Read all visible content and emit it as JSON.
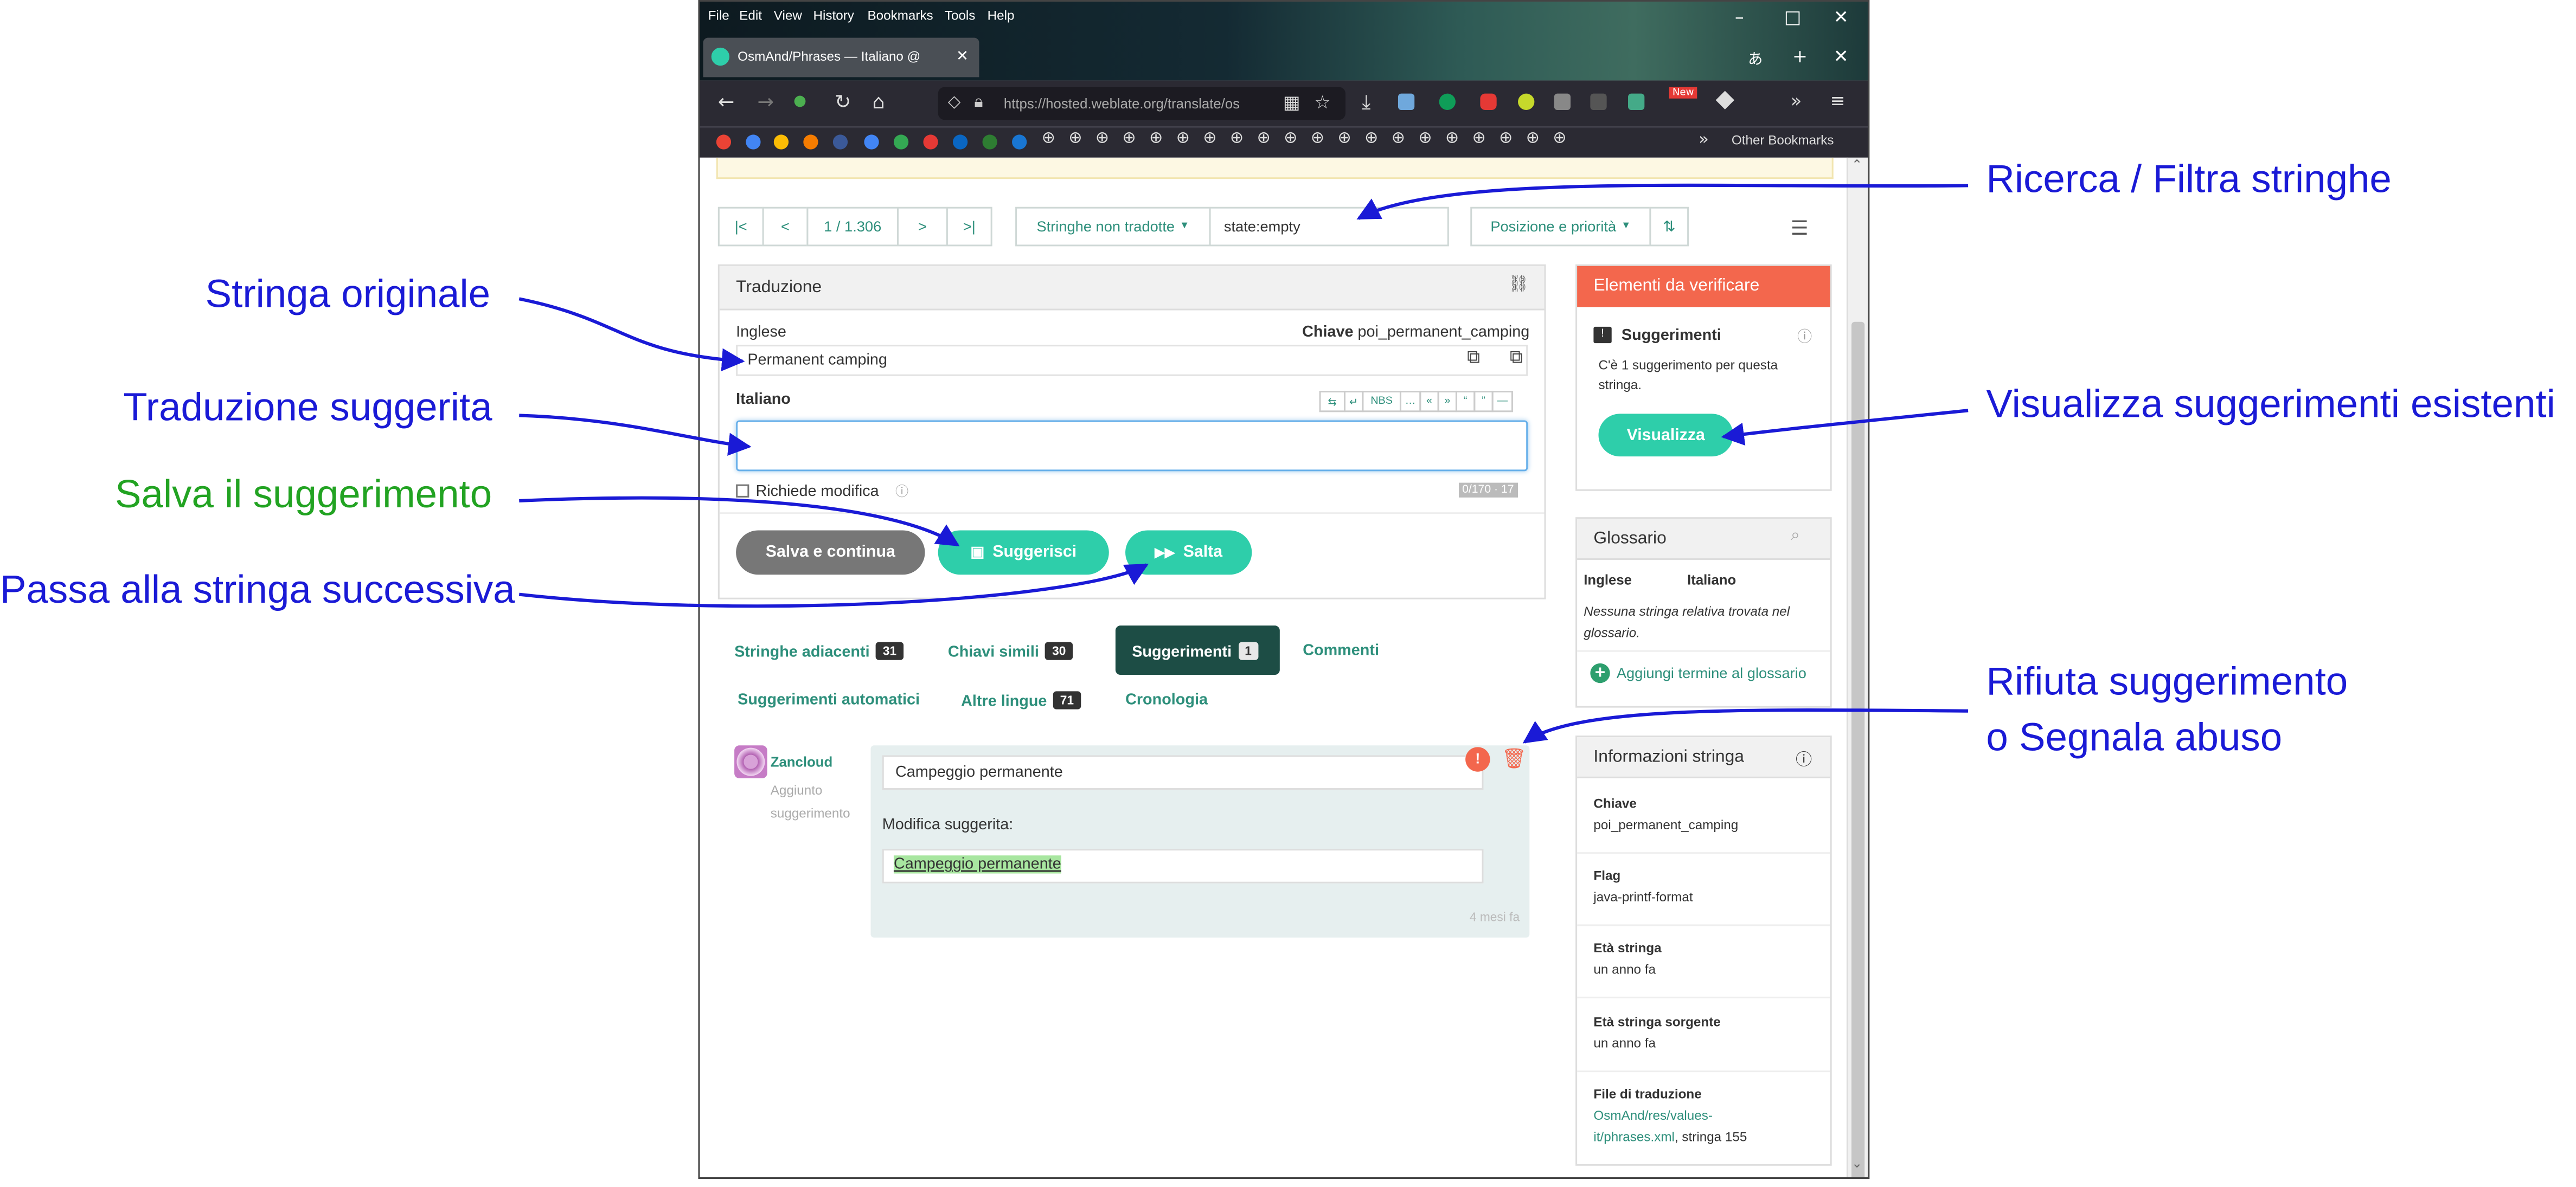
{
  "browser": {
    "menu": [
      "File",
      "Edit",
      "View",
      "History",
      "Bookmarks",
      "Tools",
      "Help"
    ],
    "tab_title": "OsmAnd/Phrases — Italiano @",
    "url": "https://hosted.weblate.org/translate/os",
    "other_bookmarks": "Other Bookmarks",
    "new_badge": "New"
  },
  "toolbar": {
    "position": "1 / 1.306",
    "filter_dropdown": "Stringhe non tradotte",
    "search_query": "state:empty",
    "sort_dropdown": "Posizione e priorità"
  },
  "translation": {
    "panel_title": "Traduzione",
    "source_lang": "Inglese",
    "key_label": "Chiave",
    "key_value": "poi_permanent_camping",
    "source_text": "Permanent camping",
    "target_lang": "Italiano",
    "kb_buttons": [
      "⇆",
      "↵",
      "NBS",
      "…",
      "«",
      "»",
      "“",
      "”",
      "—"
    ],
    "needs_edit_label": "Richiede modifica",
    "char_counter": "0/170 · 17",
    "save_button": "Salva e continua",
    "suggest_button": "Suggerisci",
    "skip_button": "Salta"
  },
  "tabs": [
    {
      "label": "Stringhe adiacenti",
      "count": "31"
    },
    {
      "label": "Chiavi simili",
      "count": "30"
    },
    {
      "label": "Suggerimenti",
      "count": "1"
    },
    {
      "label": "Commenti",
      "count": ""
    },
    {
      "label": "Suggerimenti automatici",
      "count": ""
    },
    {
      "label": "Altre lingue",
      "count": "71"
    },
    {
      "label": "Cronologia",
      "count": ""
    }
  ],
  "suggestion": {
    "user": "Zancloud",
    "action_line1": "Aggiunto",
    "action_line2": "suggerimento",
    "text": "Campeggio permanente",
    "diff_label": "Modifica suggerita:",
    "diff_text": "Campeggio permanente",
    "age": "4 mesi fa"
  },
  "sidebar": {
    "check_title": "Elementi da verificare",
    "check_heading": "Suggerimenti",
    "check_desc_1": "C'è 1 suggerimento per questa",
    "check_desc_2": "stringa.",
    "view_button": "Visualizza",
    "glossary_title": "Glossario",
    "glossary_col1": "Inglese",
    "glossary_col2": "Italiano",
    "glossary_empty_1": "Nessuna stringa relativa trovata nel",
    "glossary_empty_2": "glossario.",
    "glossary_add": "Aggiungi termine al glossario",
    "info_title": "Informazioni stringa",
    "info": [
      {
        "label": "Chiave",
        "value": "poi_permanent_camping"
      },
      {
        "label": "Flag",
        "value": "java-printf-format"
      },
      {
        "label": "Età stringa",
        "value": "un anno fa"
      },
      {
        "label": "Età stringa sorgente",
        "value": "un anno fa"
      },
      {
        "label": "File di traduzione",
        "value": "OsmAnd/res/values-",
        "value2": "it/phrases.xml",
        "value3": ", stringa 155"
      }
    ]
  },
  "annotations": {
    "search_filter": "Ricerca / Filtra stringhe",
    "original": "Stringa originale",
    "suggested": "Traduzione suggerita",
    "save_suggestion": "Salva il suggerimento",
    "next_string": "Passa alla stringa successiva",
    "view_existing": "Visualizza suggerimenti esistenti",
    "reject_line1": "Rifiuta suggerimento",
    "reject_line2": "o Segnala abuso"
  },
  "colors": {
    "accent": "#2eceaa",
    "link": "#2d8f7b",
    "danger": "#f3674d",
    "annotation": "#1a1ad6",
    "annotation_green": "#22a322"
  }
}
